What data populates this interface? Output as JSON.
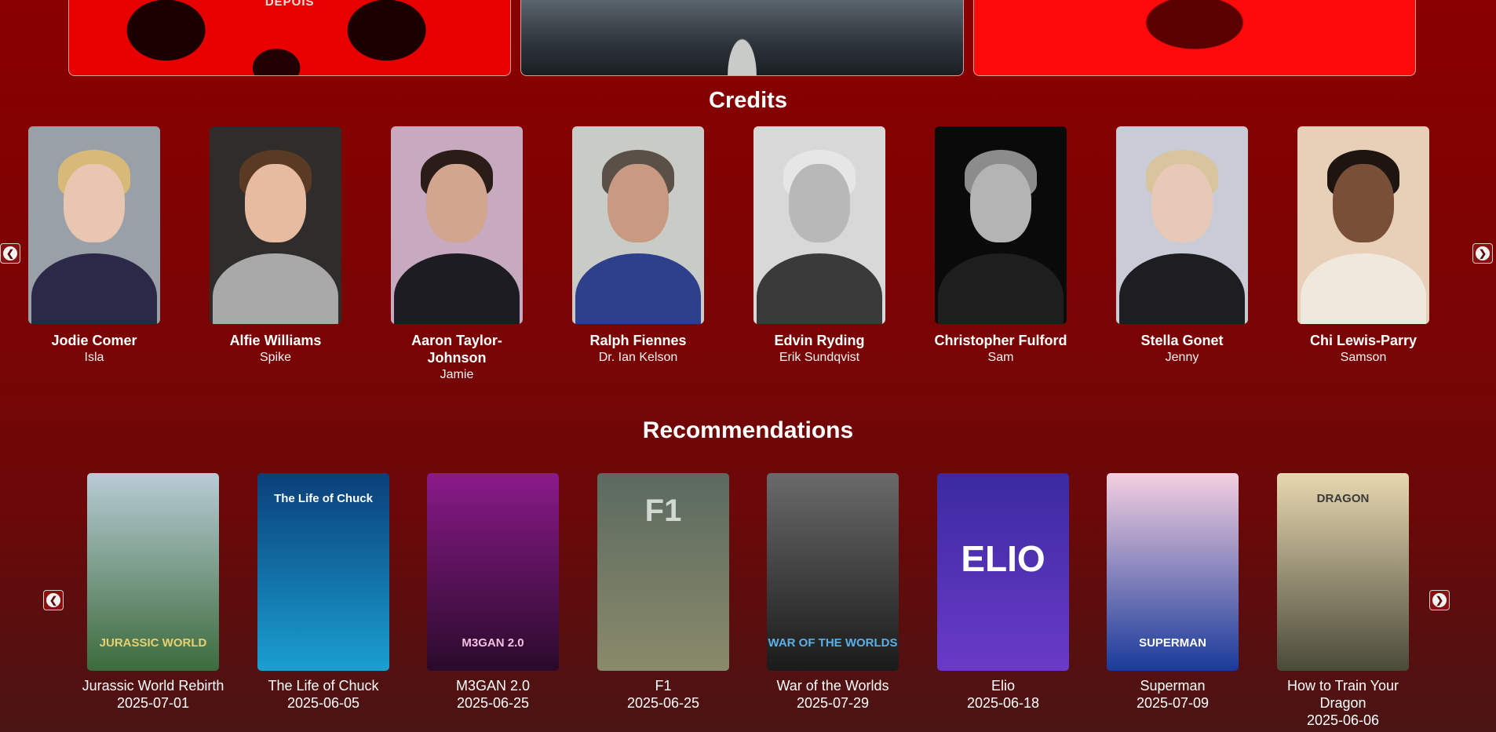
{
  "banners": [
    {
      "text": "DEPOIS",
      "name": "banner-28-years-later-red"
    },
    {
      "text": "",
      "name": "banner-bone-temple"
    },
    {
      "text": "",
      "name": "banner-red-skull"
    }
  ],
  "credits": {
    "title": "Credits",
    "cast": [
      {
        "name": "Jodie Comer",
        "role": "Isla",
        "colors": {
          "bg": "#9aa0a8",
          "hair": "#d8b978",
          "skin": "#e9c6b2",
          "body": "#2a2a48"
        }
      },
      {
        "name": "Alfie Williams",
        "role": "Spike",
        "colors": {
          "bg": "#2f2d2b",
          "hair": "#5a3a22",
          "skin": "#e6bba0",
          "body": "#a9a9a9"
        }
      },
      {
        "name": "Aaron Taylor-Johnson",
        "role": "Jamie",
        "colors": {
          "bg": "#c7a9c0",
          "hair": "#2a1d18",
          "skin": "#d2a58e",
          "body": "#1c1c22"
        }
      },
      {
        "name": "Ralph Fiennes",
        "role": "Dr. Ian Kelson",
        "colors": {
          "bg": "#c9ccc6",
          "hair": "#5a5048",
          "skin": "#c99a82",
          "body": "#2e3f8c"
        }
      },
      {
        "name": "Edvin Ryding",
        "role": "Erik Sundqvist",
        "colors": {
          "bg": "#d8d8d8",
          "hair": "#e6e6e6",
          "skin": "#b8b8b8",
          "body": "#3a3a3a"
        }
      },
      {
        "name": "Christopher Fulford",
        "role": "Sam",
        "colors": {
          "bg": "#0a0a0a",
          "hair": "#8c8c8c",
          "skin": "#b4b4b4",
          "body": "#1e1e1e"
        }
      },
      {
        "name": "Stella Gonet",
        "role": "Jenny",
        "colors": {
          "bg": "#c9ccd6",
          "hair": "#d8c5a0",
          "skin": "#e8c8b6",
          "body": "#1e1e22"
        }
      },
      {
        "name": "Chi Lewis-Parry",
        "role": "Samson",
        "colors": {
          "bg": "#e8cfb8",
          "hair": "#1e1410",
          "skin": "#7a4f38",
          "body": "#efe9dd"
        }
      }
    ]
  },
  "recommendations": {
    "title": "Recommendations",
    "items": [
      {
        "title": "Jurassic World Rebirth",
        "date": "2025-07-01",
        "poster_text": "JURASSIC WORLD",
        "colors": {
          "top": "#b8ccd6",
          "bottom": "#3c6b3c",
          "text": "#e8d070"
        }
      },
      {
        "title": "The Life of Chuck",
        "date": "2025-06-05",
        "poster_text": "The Life of Chuck",
        "colors": {
          "top": "#0a3f7a",
          "bottom": "#1a9fd0",
          "text": "#ffffff"
        }
      },
      {
        "title": "M3GAN 2.0",
        "date": "2025-06-25",
        "poster_text": "M3GAN 2.0",
        "colors": {
          "top": "#8a1a8a",
          "bottom": "#2a0a2a",
          "text": "#f4c0e0"
        }
      },
      {
        "title": "F1",
        "date": "2025-06-25",
        "poster_text": "F1",
        "colors": {
          "top": "#5a6a60",
          "bottom": "#8a8a6a",
          "text": "#d0d8d0"
        }
      },
      {
        "title": "War of the Worlds",
        "date": "2025-07-29",
        "poster_text": "WAR OF THE WORLDS",
        "colors": {
          "top": "#6a6a6a",
          "bottom": "#1a1a1a",
          "text": "#5ab0e8"
        }
      },
      {
        "title": "Elio",
        "date": "2025-06-18",
        "poster_text": "ELIO",
        "colors": {
          "top": "#3a2aa0",
          "bottom": "#6a3ac8",
          "text": "#ffffff"
        }
      },
      {
        "title": "Superman",
        "date": "2025-07-09",
        "poster_text": "SUPERMAN",
        "colors": {
          "top": "#f4d0e0",
          "bottom": "#1a3a9a",
          "text": "#ffffff"
        }
      },
      {
        "title": "How to Train Your Dragon",
        "date": "2025-06-06",
        "poster_text": "DRAGON",
        "colors": {
          "top": "#e8d8b0",
          "bottom": "#4a4a3a",
          "text": "#3a3a3a"
        }
      }
    ]
  },
  "icons": {
    "prev": "chevron-left-icon",
    "next": "chevron-right-icon",
    "prev_glyph": "❮",
    "next_glyph": "❯"
  }
}
